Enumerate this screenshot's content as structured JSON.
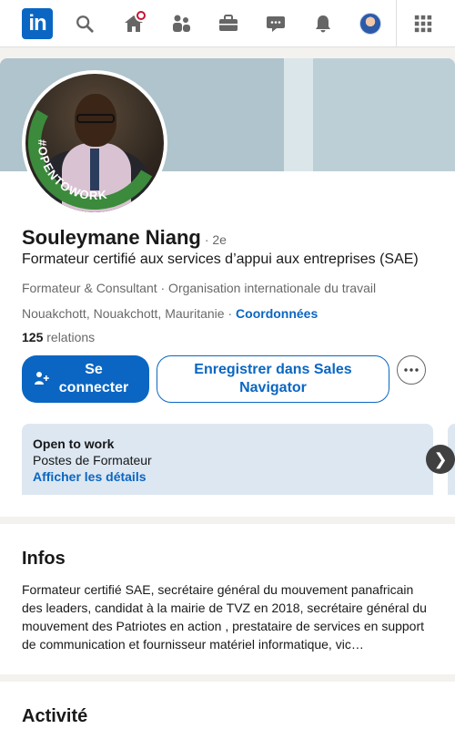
{
  "nav": {
    "logo_text": "in",
    "icons": [
      "search-icon",
      "home-icon",
      "network-icon",
      "jobs-icon",
      "messaging-icon",
      "notifications-icon",
      "me-avatar",
      "apps-grid-icon"
    ]
  },
  "profile": {
    "name": "Souleymane Niang",
    "degree": "· 2e",
    "headline": "Formateur certifié aux services d’appui aux entreprises (SAE)",
    "company": "Formateur & Consultant · Organisation internationale du travail",
    "location": "Nouakchott, Nouakchott, Mauritanie",
    "location_sep": " · ",
    "contact_link": "Coordonnées",
    "connections_count": "125",
    "connections_label": " relations",
    "frame_text": "#OPENTOWORK",
    "connect_button": "Se connecter",
    "sales_nav_button": "Enregistrer dans Sales Navigator"
  },
  "open_to_work": {
    "title": "Open to work",
    "subtitle": "Postes de Formateur",
    "link": "Afficher les détails",
    "next": "❯"
  },
  "about": {
    "heading": "Infos",
    "text": "Formateur certifié SAE, secrétaire général du mouvement panafricain des leaders, candidat à la mairie de TVZ en 2018, secrétaire général du mouvement des Patriotes en action , prestataire de services en support de communication et fournisseur matériel informatique, vic…"
  },
  "activity": {
    "heading": "Activité"
  },
  "colors": {
    "brand": "#0a66c2",
    "open_to_work_green": "#3c8a3c",
    "notification_red": "#cb112d"
  }
}
